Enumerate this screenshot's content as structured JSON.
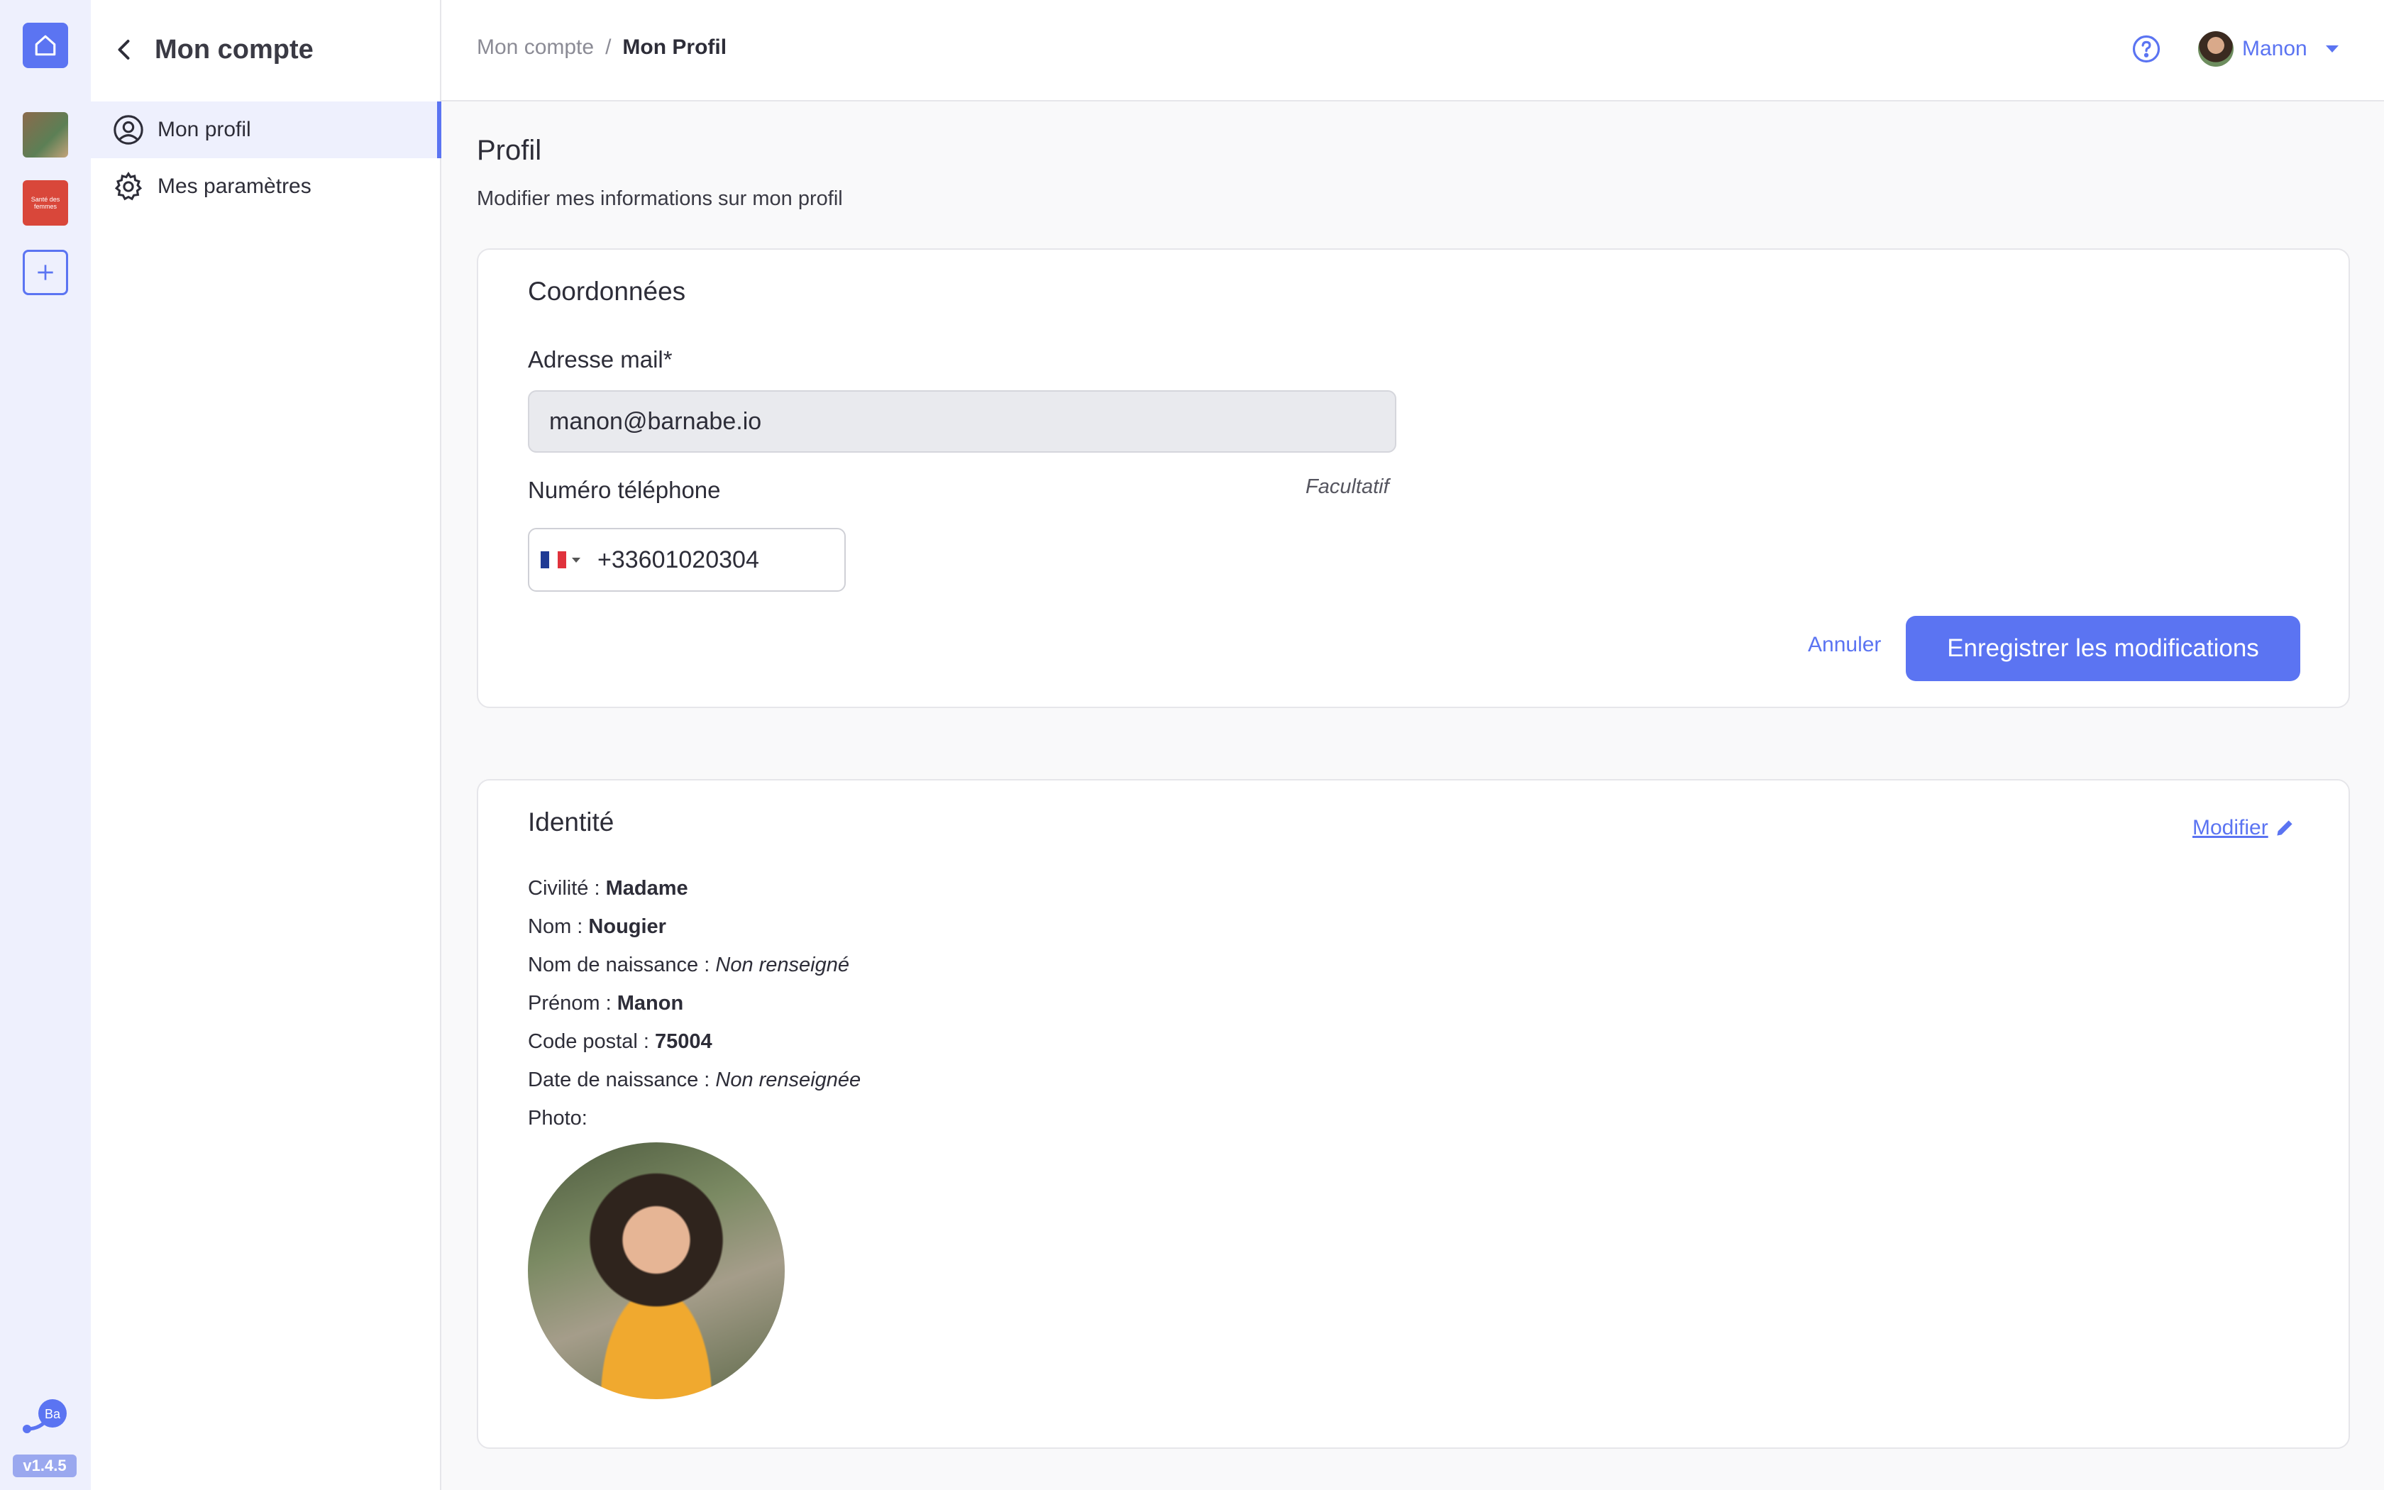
{
  "rail": {
    "org_label": "Santé des femmes",
    "brand_badge": "Ba",
    "version": "v1.4.5"
  },
  "subnav": {
    "title": "Mon compte",
    "items": [
      {
        "label": "Mon profil",
        "icon": "user-circle-icon",
        "active": true
      },
      {
        "label": "Mes paramètres",
        "icon": "gear-icon",
        "active": false
      }
    ]
  },
  "topbar": {
    "breadcrumb": [
      "Mon compte",
      "Mon Profil"
    ],
    "separator": "/",
    "user_name": "Manon"
  },
  "page": {
    "title": "Profil",
    "subtitle": "Modifier mes informations sur mon profil"
  },
  "coords": {
    "title": "Coordonnées",
    "email_label": "Adresse mail*",
    "email_value": "manon@barnabe.io",
    "phone_label": "Numéro téléphone",
    "phone_optional": "Facultatif",
    "phone_value": "+33601020304",
    "cancel_label": "Annuler",
    "save_label": "Enregistrer les modifications"
  },
  "identity": {
    "title": "Identité",
    "modify_label": "Modifier",
    "fields": [
      {
        "label": "Civilité :",
        "value": "Madame"
      },
      {
        "label": "Nom :",
        "value": "Nougier"
      },
      {
        "label": "Nom de naissance :",
        "value": "Non renseigné"
      },
      {
        "label": "Prénom :",
        "value": "Manon"
      },
      {
        "label": "Code postal :",
        "value": "75004"
      },
      {
        "label": "Date de naissance :",
        "value": "Non renseignée"
      },
      {
        "label": "Photo:",
        "value": ""
      }
    ]
  },
  "colors": {
    "accent": "#5b74f2",
    "rail_bg": "#eef0fd"
  }
}
